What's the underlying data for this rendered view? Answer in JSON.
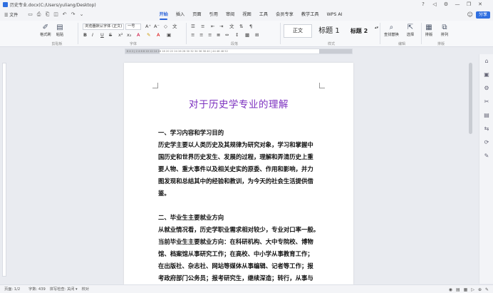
{
  "window": {
    "title": "历史专业.docx(C:/Users/yuliang/Desktop)",
    "controls": {
      "minimize": "—",
      "maximize": "❐",
      "close": "✕",
      "back": "◁",
      "settings": "⚙"
    }
  },
  "menubar": {
    "file_label": "☰ 文件",
    "tabs": [
      "开始",
      "插入",
      "页面",
      "引用",
      "审阅",
      "视图",
      "工具",
      "会员专享",
      "教学工具",
      "WPS AI"
    ],
    "active_tab": "开始",
    "share_label": "分享"
  },
  "ribbon": {
    "clipboard": {
      "format_painter": "格式刷",
      "paste": "粘贴",
      "group_label": "剪贴板"
    },
    "font": {
      "font_name": "浏览器默认字体 (正文)",
      "font_size": "一号",
      "group_label": "字体",
      "bold": "B",
      "italic": "I",
      "underline": "U",
      "strike": "S"
    },
    "paragraph": {
      "group_label": "段落"
    },
    "styles": {
      "normal": "正文",
      "heading1": "标题 1",
      "heading2": "标题 2",
      "group_label": "样式"
    },
    "editing": {
      "find_replace": "查找替换",
      "select": "选择",
      "group_label": "编辑"
    },
    "layout": {
      "sort": "排版",
      "arrange": "排列",
      "group_label": "排版"
    }
  },
  "ruler": {
    "ticks": "6 4 2 | 2 4 6 8 10 12 14 16 18 20 22 24 26 28 30 32 34 36 38 40 | 44 46 48 52"
  },
  "document": {
    "title": "对于历史学专业的理解",
    "paragraphs": [
      "一、学习内容和学习目的",
      "历史学主要以人类历史及其规律为研究对象，学习和掌握中",
      "国历史和世界历史发生、发展的过程，理解和弄清历史上重",
      "要人物、重大事件以及相关史实的原委、作用和影响，并力",
      "图发现和总结其中的经验和教训，为今天的社会生活提供借",
      "鉴。",
      "",
      "二、毕业生主要就业方向",
      "从就业情况看，历史学职业需求相对较少，专业对口率一般。",
      "当前毕业生主要就业方向：在科研机构、大中专院校、博物",
      "馆、档案馆从事研究工作；在高校、中小学从事教育工作；",
      "在出版社、杂志社、网站等媒体从事编辑、记者等工作；报",
      "考政府部门公务员；报考研究生，继续深造；转行，从事与"
    ]
  },
  "statusbar": {
    "page": "页面: 1/2",
    "words": "字数: 439",
    "spell": "拼写检查: 关闭 ▾",
    "proof": "校对",
    "zoom_icons": [
      "◉",
      "▤",
      "▦",
      "▷",
      "⊕",
      "✎"
    ]
  },
  "sidebar_icons": [
    "⌂",
    "▣",
    "⚙",
    "✂",
    "▤",
    "⇆",
    "⟳",
    "✎"
  ],
  "colors": {
    "accent": "#2b63d9",
    "title_purple": "#7b2fbf"
  }
}
